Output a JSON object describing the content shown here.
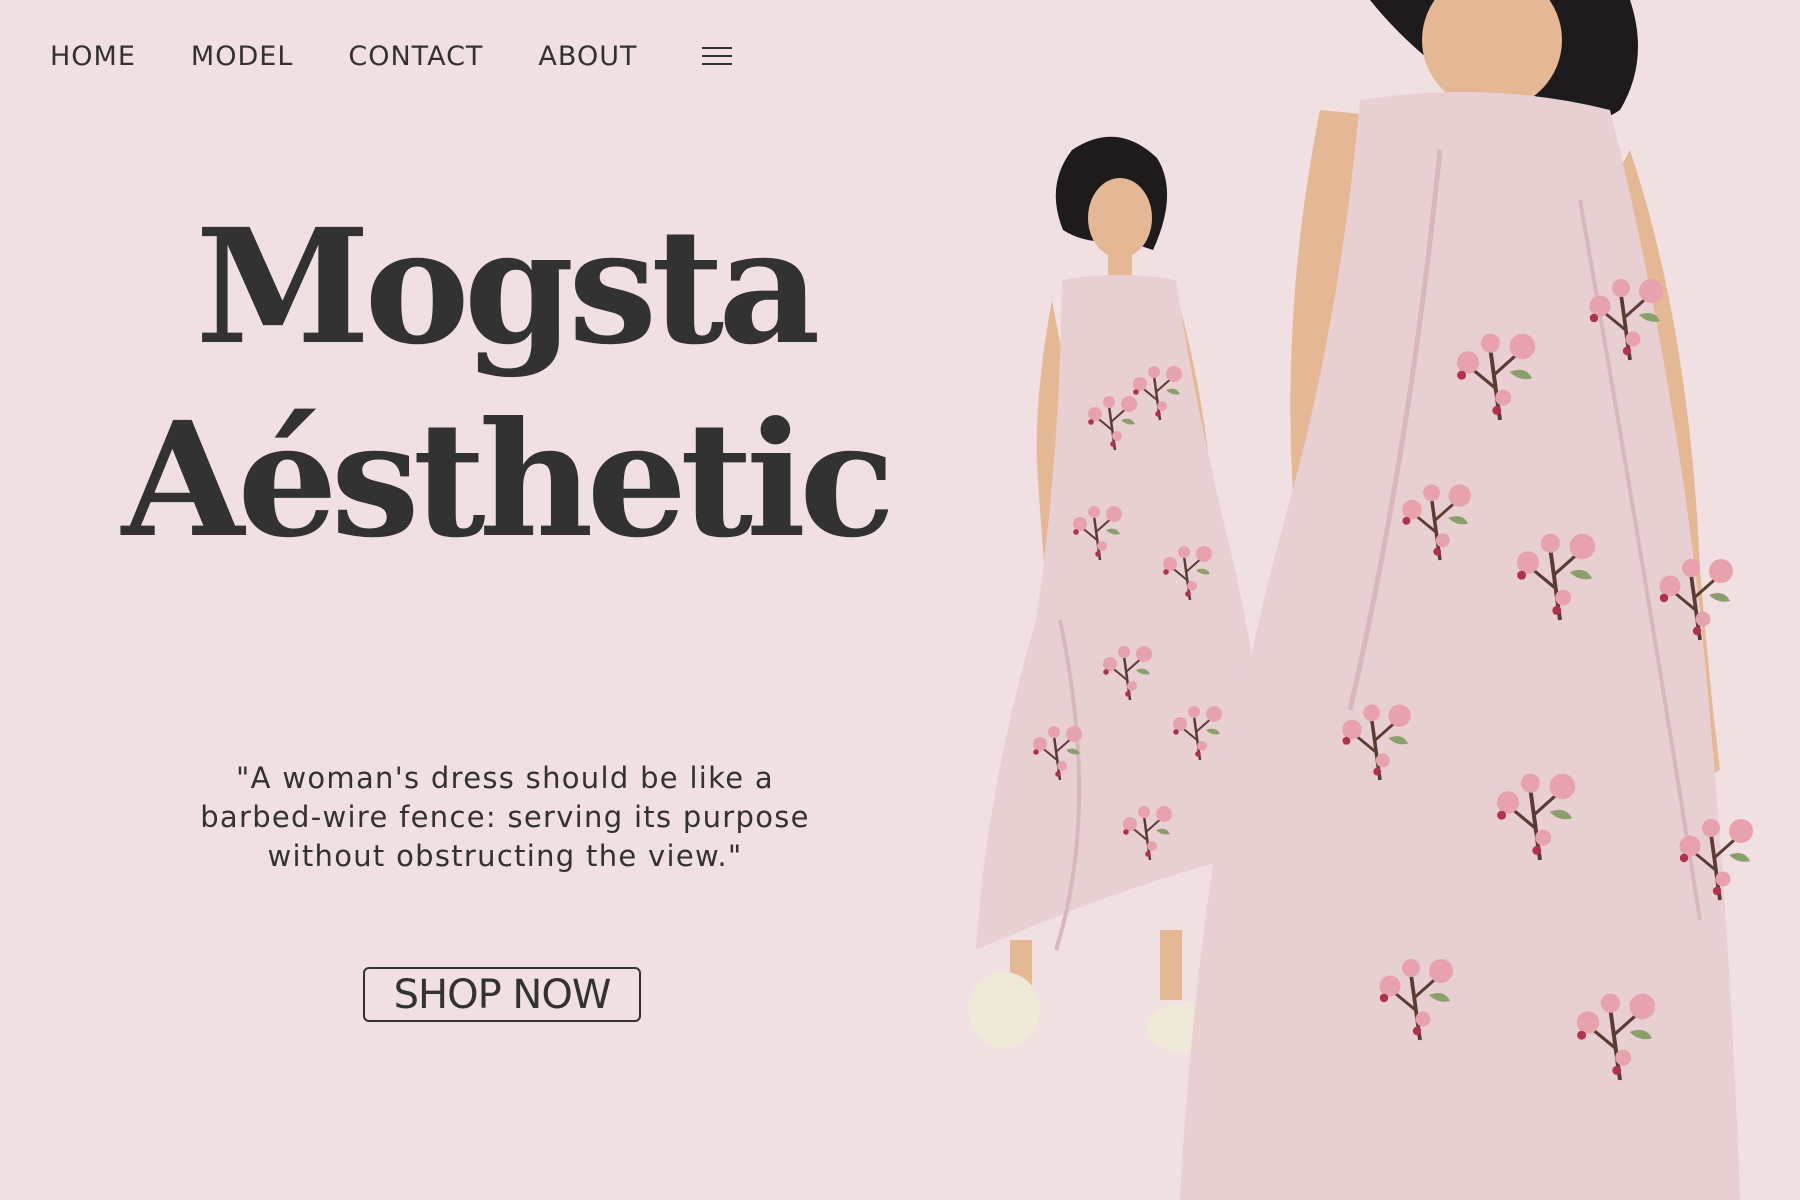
{
  "colors": {
    "background": "#f1e0e1",
    "text": "#333232",
    "dress": "#e8cfd2",
    "dress_shadow": "#d7b7bc",
    "blossom": "#e7a2ae",
    "blossom_dark": "#b0324c",
    "branch": "#5b3b33",
    "leaf": "#8aa06a",
    "skin": "#e5b895",
    "hair": "#1d1b1c",
    "shoe": "#efe9d8"
  },
  "nav": {
    "items": [
      {
        "label": "HOME"
      },
      {
        "label": "MODEL"
      },
      {
        "label": "CONTACT"
      },
      {
        "label": "ABOUT"
      }
    ],
    "menu_icon": "hamburger-menu-icon"
  },
  "hero": {
    "title_line1": "Mogsta",
    "title_line2": "Aésthetic",
    "quote": "\"A woman's dress should be like a\nbarbed-wire fence: serving its purpose\nwithout obstructing the view.\"",
    "cta_label": "SHOP NOW"
  },
  "images": {
    "models": "two-models-in-floral-dress"
  }
}
